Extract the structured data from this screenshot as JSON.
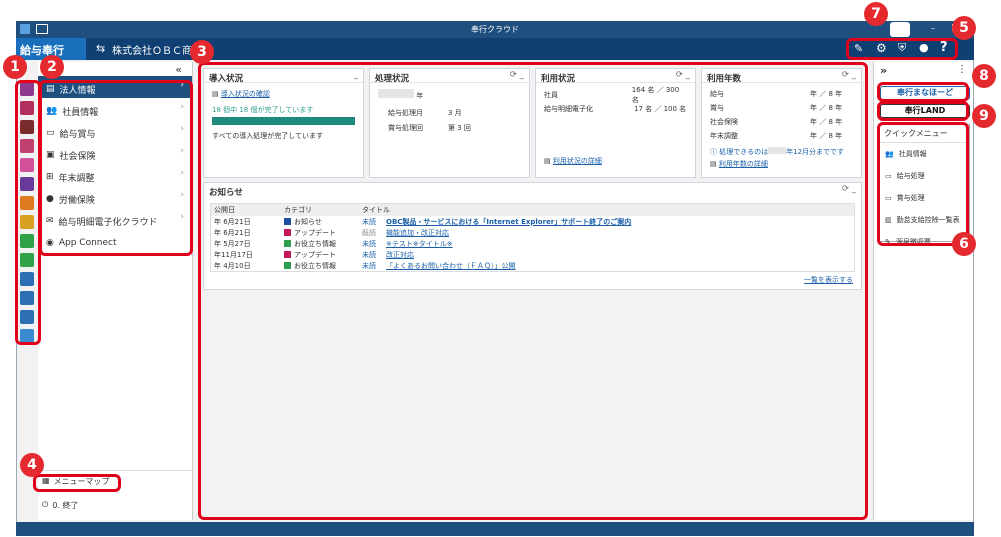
{
  "window": {
    "title": "奉行クラウド"
  },
  "app": {
    "product": "給与奉行",
    "company": "株式会社ＯＢＣ商"
  },
  "colors": {
    "titlebar": "#1e4f7f",
    "appbar": "#0f3f73",
    "accent": "#1a5fa8",
    "callout": "#e42a2f"
  },
  "sidebar": {
    "collapse": "«",
    "items": [
      {
        "label": "法人情報",
        "icon": "building-icon"
      },
      {
        "label": "社員情報",
        "icon": "people-icon"
      },
      {
        "label": "給与賞与",
        "icon": "money-icon"
      },
      {
        "label": "社会保険",
        "icon": "insurance-icon"
      },
      {
        "label": "年末調整",
        "icon": "grid-icon"
      },
      {
        "label": "労働保険",
        "icon": "person-icon"
      },
      {
        "label": "給与明細電子化クラウド",
        "icon": "mail-icon"
      },
      {
        "label": "App Connect",
        "icon": "connect-icon"
      }
    ],
    "menu_map": "メニューマップ",
    "exit": "0. 終了"
  },
  "panels": {
    "intro": {
      "title": "導入状況",
      "link": "導入状況の確認",
      "progress_text": "18 個中 18 個が完了しています",
      "progress": 1.0,
      "done": "すべての導入処理が完了しています"
    },
    "process": {
      "title": "処理状況",
      "year_suffix": "年",
      "rows": [
        {
          "label": "給与処理月",
          "value": "3 月"
        },
        {
          "label": "賞与処理回",
          "value": "第 3 回"
        }
      ]
    },
    "usage": {
      "title": "利用状況",
      "rows": [
        {
          "label": "社員",
          "value": "164 名 ／ 300 名"
        },
        {
          "label": "給与明細電子化",
          "value": "17 名 ／ 100 名"
        }
      ],
      "link": "利用状況の詳細"
    },
    "years": {
      "title": "利用年数",
      "rows": [
        {
          "label": "給与",
          "value": "年 ／ 8 年"
        },
        {
          "label": "賞与",
          "value": "年 ／ 8 年"
        },
        {
          "label": "社会保険",
          "value": "年 ／ 8 年"
        },
        {
          "label": "年末調整",
          "value": "年 ／ 8 年"
        }
      ],
      "notice_a": "処理できるのは",
      "notice_b": "年12月分までです",
      "link": "利用年数の詳細"
    }
  },
  "news": {
    "title": "お知らせ",
    "headers": [
      "公開日",
      "カテゴリ",
      "タイトル"
    ],
    "rows": [
      {
        "date": "年  6月21日",
        "cat": "お知らせ",
        "color": "#1f4fa0",
        "status": "未読",
        "title": "OBC製品・サービスにおける「Internet Explorer」サポート終了のご案内"
      },
      {
        "date": "年  6月21日",
        "cat": "アップデート",
        "color": "#c2185b",
        "status": "既読",
        "title": "機能追加・改正対応"
      },
      {
        "date": "年  5月27日",
        "cat": "お役立ち情報",
        "color": "#2e9e4f",
        "status": "未読",
        "title": "※テスト※タイトル※"
      },
      {
        "date": "年11月17日",
        "cat": "アップデート",
        "color": "#c2185b",
        "status": "未読",
        "title": "改正対応"
      },
      {
        "date": "年  4月10日",
        "cat": "お役立ち情報",
        "color": "#2e9e4f",
        "status": "未読",
        "title": "「よくあるお問い合わせ（ＦＡＱ）」公開"
      }
    ],
    "more": "一覧を表示する"
  },
  "right": {
    "expand": "»",
    "support": "奉行まなほーど",
    "land": "奉行LAND",
    "quick_title": "クイックメニュー",
    "quick": [
      "社員情報",
      "給与処理",
      "賞与処理",
      "勤怠支給控除一覧表",
      "源泉徴収票"
    ]
  },
  "callouts": [
    "1",
    "2",
    "3",
    "4",
    "5",
    "6",
    "7",
    "8",
    "9"
  ]
}
